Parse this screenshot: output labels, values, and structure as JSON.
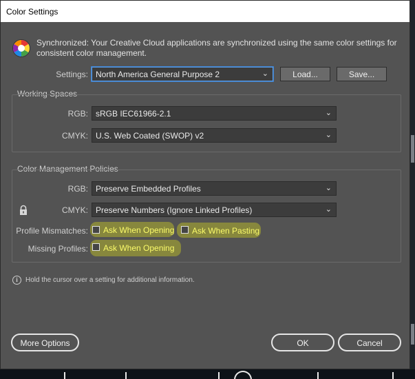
{
  "window": {
    "title": "Color Settings"
  },
  "sync": {
    "icon": "color-wheel-icon",
    "line1": "Synchronized: Your Creative Cloud applications are synchronized using the same color settings for",
    "line2": "consistent color management."
  },
  "settings": {
    "label": "Settings:",
    "value": "North America General Purpose 2",
    "load_label": "Load...",
    "save_label": "Save..."
  },
  "working_spaces": {
    "title": "Working Spaces",
    "rgb_label": "RGB:",
    "rgb_value": "sRGB IEC61966-2.1",
    "cmyk_label": "CMYK:",
    "cmyk_value": "U.S. Web Coated (SWOP) v2"
  },
  "policies": {
    "title": "Color Management Policies",
    "rgb_label": "RGB:",
    "rgb_value": "Preserve Embedded Profiles",
    "cmyk_label": "CMYK:",
    "cmyk_value": "Preserve Numbers (Ignore Linked Profiles)",
    "mismatch_label": "Profile Mismatches:",
    "mismatch_opening": "Ask When Opening",
    "mismatch_pasting": "Ask When Pasting",
    "missing_label": "Missing Profiles:",
    "missing_opening": "Ask When Opening"
  },
  "info": {
    "text": "Hold the cursor over a setting for additional information."
  },
  "footer": {
    "more_options": "More Options",
    "ok": "OK",
    "cancel": "Cancel"
  },
  "colors": {
    "dialog_bg": "#535353",
    "highlight": "#d6d61e",
    "accent_focus": "#5d9ee6"
  }
}
